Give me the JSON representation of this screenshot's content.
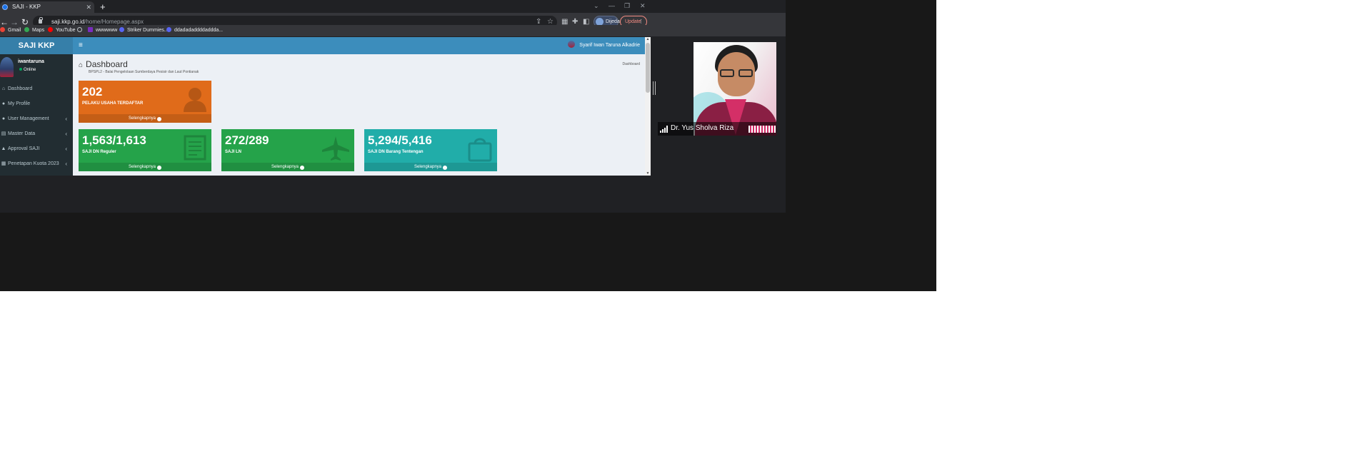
{
  "browser": {
    "tab_title": "SAJI - KKP",
    "new_tab_symbol": "+",
    "url_domain": "saji.kkp.go.id",
    "url_path": "/home/Homepage.aspx",
    "profile_label": "Dijeda",
    "update_label": "Update",
    "bookmarks": [
      "Gmail",
      "Maps",
      "YouTube",
      "",
      "wwwwww",
      "Striker Dummies...",
      "ddadadaddddaddda..."
    ]
  },
  "sidebar": {
    "logo": "SAJI KKP",
    "user_name": "iwantaruna",
    "user_status": "Online",
    "items": [
      {
        "label": "Dashboard",
        "icon": "home-icon",
        "has_chevron": false
      },
      {
        "label": "My Profile",
        "icon": "user-icon",
        "has_chevron": false
      },
      {
        "label": "User Management",
        "icon": "users-icon",
        "has_chevron": true
      },
      {
        "label": "Master Data",
        "icon": "table-icon",
        "has_chevron": true
      },
      {
        "label": "Approval SAJI",
        "icon": "lock-icon",
        "has_chevron": true
      },
      {
        "label": "Penetapan Kuota 2023",
        "icon": "calendar-icon",
        "has_chevron": true
      }
    ]
  },
  "topbar": {
    "user_full_name": "Syarif Iwan Taruna Alkadrie"
  },
  "content": {
    "title": "Dashboard",
    "subtitle": "BPSPL2 - Balai Pengelolaan Sumberdaya Pesisir dan Laut Pontianak",
    "breadcrumb": "Dashboard",
    "cards": [
      {
        "value": "202",
        "label": "PELAKU USAHA TERDAFTAR",
        "footer": "Selengkapnya",
        "color": "#e06b1a",
        "icon": "person-icon"
      },
      {
        "value": "1,563/1,613",
        "label": "SAJI DN Reguler",
        "footer": "Selengkapnya",
        "color": "#25a34a",
        "icon": "document-icon"
      },
      {
        "value": "272/289",
        "label": "SAJI LN",
        "footer": "Selengkapnya",
        "color": "#25a34a",
        "icon": "airplane-icon"
      },
      {
        "value": "5,294/5,416",
        "label": "SAJI DN Barang Tentengan",
        "footer": "Selengkapnya",
        "color": "#21ada9",
        "icon": "shopping-bag-icon"
      }
    ]
  },
  "video": {
    "participant_name": "Dr. Yus Sholva Riza"
  },
  "colors": {
    "sidebar_bg": "#222d32",
    "logo_bg": "#367fa9",
    "topnav_bg": "#3c8dbc",
    "content_bg": "#ecf0f5"
  }
}
